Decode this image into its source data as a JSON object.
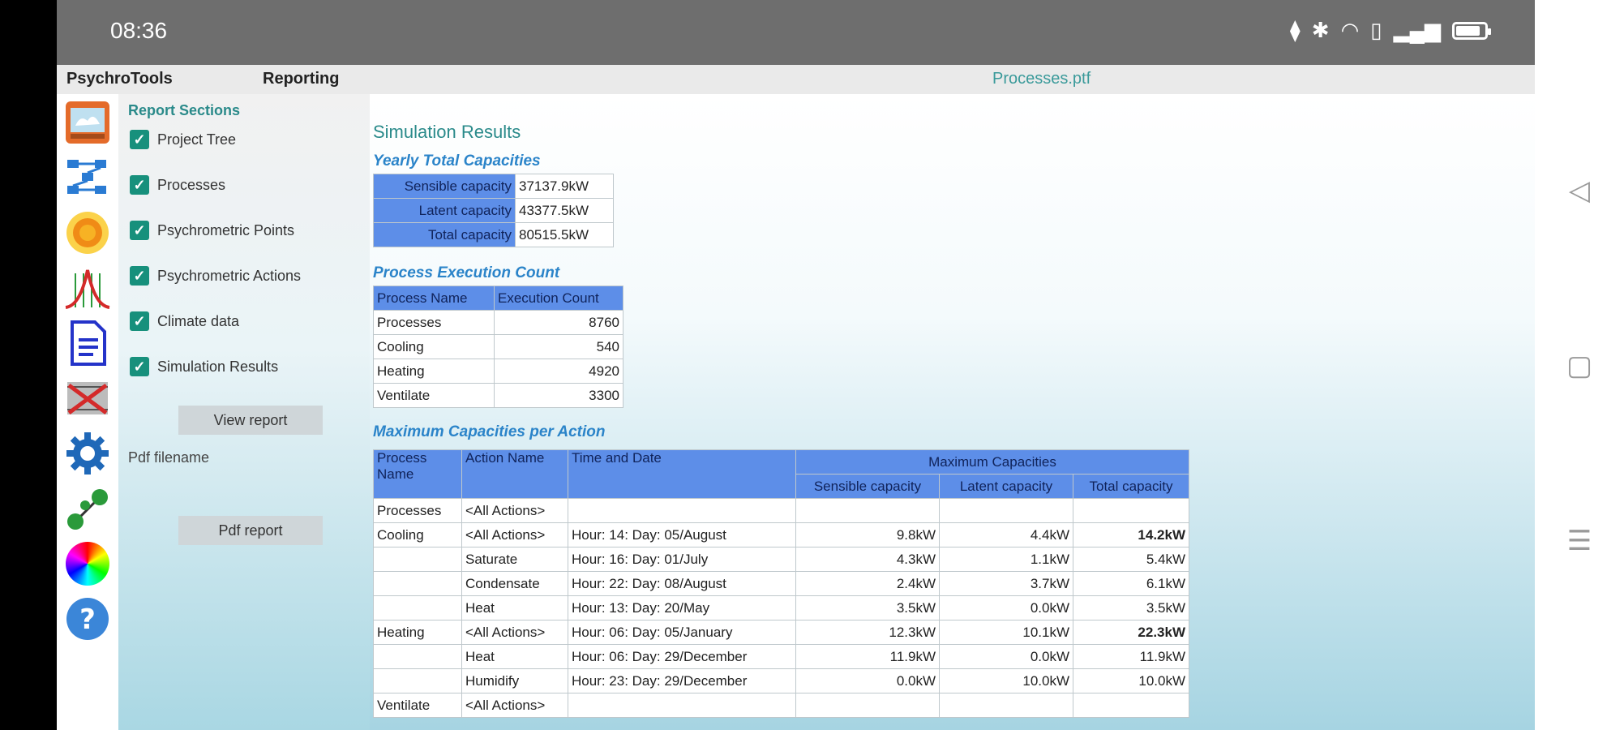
{
  "status_bar": {
    "time": "08:36",
    "battery_level": 0.85
  },
  "menu": {
    "app_name": "PsychroTools",
    "section": "Reporting",
    "document_title": "Processes.ptf"
  },
  "tools": [
    "home-building-icon",
    "process-flow-icon",
    "sun-icon",
    "chart-curve-icon",
    "document-icon",
    "psychrometric-cross-icon",
    "gear-icon",
    "connections-icon",
    "color-wheel-icon",
    "help-icon"
  ],
  "side_panel": {
    "heading": "Report Sections",
    "sections": [
      {
        "label": "Project Tree",
        "checked": true
      },
      {
        "label": "Processes",
        "checked": true
      },
      {
        "label": "Psychrometric Points",
        "checked": true
      },
      {
        "label": "Psychrometric Actions",
        "checked": true
      },
      {
        "label": "Climate data",
        "checked": true
      },
      {
        "label": "Simulation Results",
        "checked": true
      }
    ],
    "view_report_label": "View report",
    "pdf_filename_label": "Pdf filename",
    "pdf_report_label": "Pdf report"
  },
  "report": {
    "title": "Simulation Results",
    "yearly": {
      "title": "Yearly Total Capacities",
      "rows": [
        {
          "label": "Sensible capacity",
          "value": "37137.9kW"
        },
        {
          "label": "Latent capacity",
          "value": "43377.5kW"
        },
        {
          "label": "Total capacity",
          "value": "80515.5kW"
        }
      ]
    },
    "execution": {
      "title": "Process Execution Count",
      "headers": [
        "Process Name",
        "Execution Count"
      ],
      "rows": [
        [
          "Processes",
          "8760"
        ],
        [
          "Cooling",
          "540"
        ],
        [
          "Heating",
          "4920"
        ],
        [
          "Ventilate",
          "3300"
        ]
      ]
    },
    "maxcap": {
      "title": "Maximum Capacities per Action",
      "headers": {
        "process": "Process Name",
        "action": "Action Name",
        "time": "Time and Date",
        "group": "Maximum Capacities",
        "sensible": "Sensible capacity",
        "latent": "Latent capacity",
        "total": "Total capacity"
      },
      "rows": [
        [
          "Processes",
          "<All Actions>",
          "",
          "",
          "",
          ""
        ],
        [
          "Cooling",
          "<All Actions>",
          "Hour: 14:  Day: 05/August",
          "9.8kW",
          "4.4kW",
          "14.2kW"
        ],
        [
          "",
          "Saturate",
          "Hour: 16:  Day: 01/July",
          "4.3kW",
          "1.1kW",
          "5.4kW"
        ],
        [
          "",
          "Condensate",
          "Hour: 22:  Day: 08/August",
          "2.4kW",
          "3.7kW",
          "6.1kW"
        ],
        [
          "",
          "Heat",
          "Hour: 13:  Day: 20/May",
          "3.5kW",
          "0.0kW",
          "3.5kW"
        ],
        [
          "Heating",
          "<All Actions>",
          "Hour: 06:  Day: 05/January",
          "12.3kW",
          "10.1kW",
          "22.3kW"
        ],
        [
          "",
          "Heat",
          "Hour: 06:  Day: 29/December",
          "11.9kW",
          "0.0kW",
          "11.9kW"
        ],
        [
          "",
          "Humidify",
          "Hour: 23:  Day: 29/December",
          "0.0kW",
          "10.0kW",
          "10.0kW"
        ],
        [
          "Ventilate",
          "<All Actions>",
          "",
          "",
          "",
          ""
        ]
      ]
    }
  }
}
